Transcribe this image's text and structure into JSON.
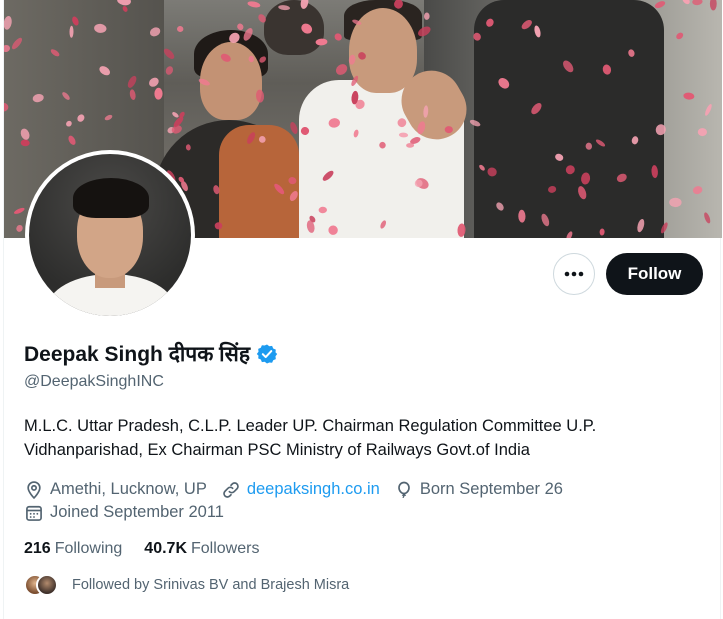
{
  "profile": {
    "display_name": "Deepak Singh दीपक सिंह",
    "handle": "@DeepakSinghINC",
    "verified_icon": "verified-badge-icon",
    "bio": "M.L.C. Uttar Pradesh, C.L.P. Leader UP. Chairman Regulation Committee U.P. Vidhanparishad, Ex Chairman PSC Ministry of Railways Govt.of India",
    "location": "Amethi, Lucknow, UP",
    "website": "deepaksingh.co.in",
    "born": "Born September 26",
    "joined": "Joined September 2011"
  },
  "actions": {
    "more_label": "•••",
    "follow_label": "Follow"
  },
  "stats": {
    "following_count": "216",
    "following_label": "Following",
    "followers_count": "40.7K",
    "followers_label": "Followers"
  },
  "followed_by": {
    "text": "Followed by Srinivas BV and Brajesh Misra"
  },
  "colors": {
    "accent": "#1d9bf0",
    "text_primary": "#0f1419",
    "text_secondary": "#536471",
    "follow_button_bg": "#0f1419",
    "petal": "#e05a74"
  }
}
